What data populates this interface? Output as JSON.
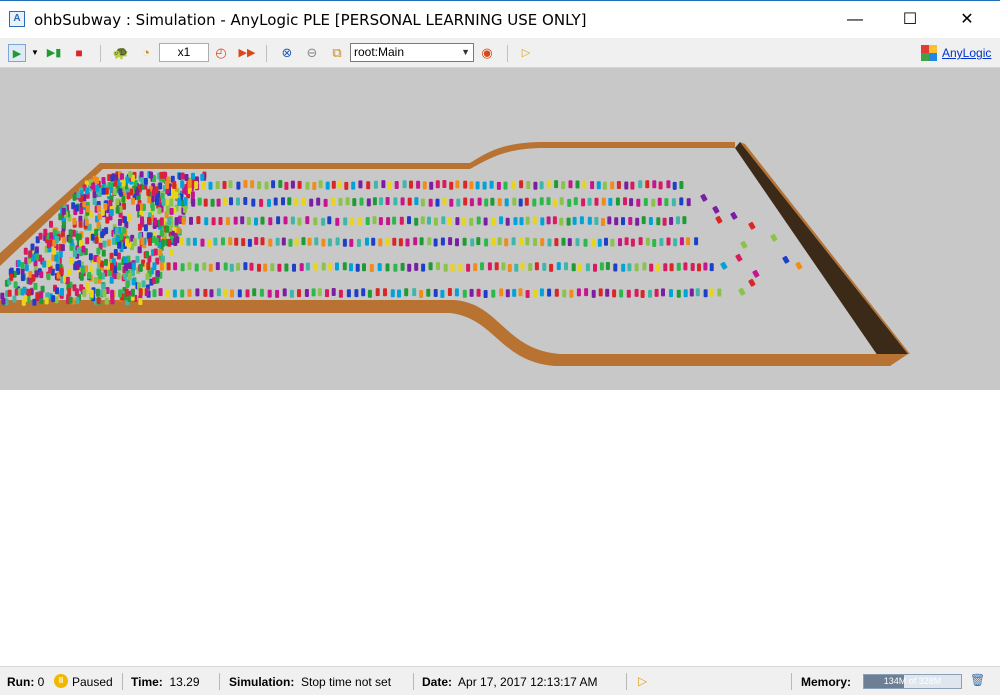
{
  "window": {
    "title": "ohbSubway : Simulation - AnyLogic PLE [PERSONAL LEARNING USE ONLY]",
    "app_icon_text": "A",
    "minimize": "—",
    "maximize": "☐",
    "close": "✕"
  },
  "toolbar": {
    "speed": "x1",
    "view_select": "root:Main",
    "logo_text": "AnyLogic",
    "icons": [
      "run-icon",
      "run-dropdown-icon",
      "step-icon",
      "stop-icon",
      "slower-icon",
      "clock-icon",
      "faster-icon",
      "realtime-icon",
      "navigate-home-icon",
      "navigate-back-icon",
      "navigate-view-icon",
      "camera-icon",
      "play-icon"
    ]
  },
  "status": {
    "run_label": "Run:",
    "run_value": "0",
    "state": "Paused",
    "time_label": "Time:",
    "time_value": "13.29",
    "simulation_label": "Simulation:",
    "simulation_value": "Stop time not set",
    "date_label": "Date:",
    "date_value": "Apr 17, 2017 12:13:17 AM",
    "memory_label": "Memory:",
    "memory_text": "134M of 328M",
    "memory_used_fraction": 0.41
  },
  "colors": {
    "wall": "#b87333",
    "wall_dark": "#3b2a18",
    "floor": "#c8c8c8",
    "agent_palette": [
      "#1f9b34",
      "#2db84a",
      "#d81b60",
      "#7b1fa2",
      "#1e40c8",
      "#00a2d8",
      "#e8d51a",
      "#d92626",
      "#8bc34a",
      "#3fb7a8",
      "#c6168d",
      "#f08c1a"
    ]
  }
}
